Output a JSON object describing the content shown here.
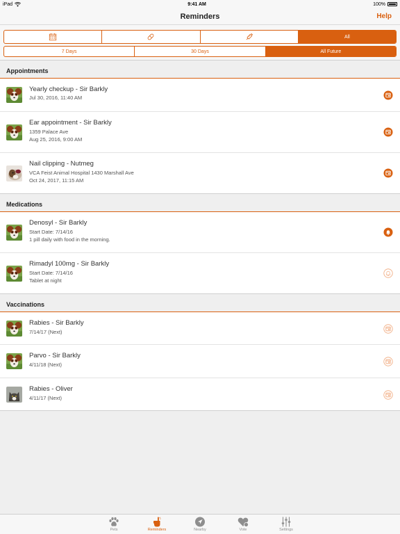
{
  "status": {
    "device": "iPad",
    "time": "9:41 AM",
    "battery": "100%"
  },
  "nav": {
    "title": "Reminders",
    "help": "Help"
  },
  "filters": {
    "types": [
      {
        "icon": "calendar-icon",
        "label": ""
      },
      {
        "icon": "pill-icon",
        "label": ""
      },
      {
        "icon": "syringe-icon",
        "label": ""
      },
      {
        "icon": "",
        "label": "All",
        "active": true
      }
    ],
    "ranges": [
      {
        "label": "7 Days",
        "active": false
      },
      {
        "label": "30 Days",
        "active": false
      },
      {
        "label": "All Future",
        "active": true
      }
    ]
  },
  "sections": {
    "appointments": {
      "title": "Appointments",
      "items": [
        {
          "title": "Yearly checkup - Sir Barkly",
          "lines": [
            "Jul 30, 2016, 11:40 AM"
          ],
          "avatar": "papillon",
          "icon": "calendar-filled-icon"
        },
        {
          "title": "Ear appointment - Sir Barkly",
          "lines": [
            "1359 Palace Ave",
            "Aug 25, 2016, 9:00 AM"
          ],
          "avatar": "papillon",
          "icon": "calendar-filled-icon"
        },
        {
          "title": "Nail clipping - Nutmeg",
          "lines": [
            "VCA Feist Animal Hospital 1430 Marshall Ave",
            "Oct 24, 2017, 11:15 AM"
          ],
          "avatar": "guinea-pig",
          "icon": "calendar-filled-icon"
        }
      ]
    },
    "medications": {
      "title": "Medications",
      "items": [
        {
          "title": "Denosyl - Sir Barkly",
          "lines": [
            "Start Date: 7/14/16",
            "1 pill daily with food in the morning."
          ],
          "avatar": "papillon",
          "icon": "bell-filled-icon"
        },
        {
          "title": "Rimadyl 100mg - Sir Barkly",
          "lines": [
            "Start Date: 7/14/16",
            "Tablet at night"
          ],
          "avatar": "papillon",
          "icon": "bell-outline-icon"
        }
      ]
    },
    "vaccinations": {
      "title": "Vaccinations",
      "items": [
        {
          "title": "Rabies - Sir Barkly",
          "lines": [
            "7/14/17 (Next)"
          ],
          "avatar": "papillon",
          "icon": "calendar-outline-icon"
        },
        {
          "title": "Parvo - Sir Barkly",
          "lines": [
            "4/11/18 (Next)"
          ],
          "avatar": "papillon",
          "icon": "calendar-outline-icon"
        },
        {
          "title": "Rabies - Oliver",
          "lines": [
            "4/11/17 (Next)"
          ],
          "avatar": "cat",
          "icon": "calendar-outline-icon"
        }
      ]
    }
  },
  "tabs": [
    {
      "label": "Pets",
      "icon": "paw-icon",
      "active": false
    },
    {
      "label": "Reminders",
      "icon": "reminder-hand-icon",
      "active": true
    },
    {
      "label": "Nearby",
      "icon": "location-arrow-icon",
      "active": false
    },
    {
      "label": "Vote",
      "icon": "heart-icon",
      "active": false
    },
    {
      "label": "Settings",
      "icon": "sliders-icon",
      "active": false
    }
  ],
  "colors": {
    "accent": "#d96010",
    "background": "#efefef",
    "text": "#333333"
  }
}
